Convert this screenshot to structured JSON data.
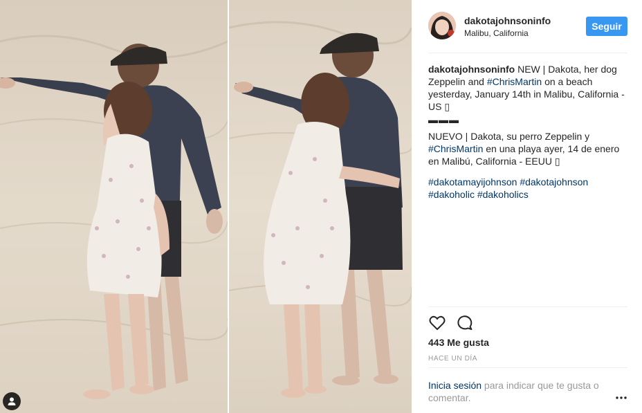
{
  "post": {
    "username": "dakotajohnsoninfo",
    "location": "Malibu, California",
    "follow_label": "Seguir"
  },
  "caption": {
    "author": "dakotajohnsoninfo",
    "part1_a": "NEW | Dakota, her dog Zeppelin and ",
    "hashtag1": "#ChrisMartin",
    "part1_b": " on a beach yesterday, January 14th in Malibu, California - US ",
    "flag1": "▯",
    "separator": "▬▬▬",
    "part2_a": "NUEVO | Dakota, su perro Zeppelin y ",
    "hashtag2": "#ChrisMartin",
    "part2_b": " en una playa ayer, 14 de enero en Malibú, California - EEUU ",
    "flag2": "▯",
    "tags": [
      "#dakotamayijohnson",
      "#dakotajohnson",
      "#dakoholic",
      "#dakoholics"
    ]
  },
  "actions": {
    "like_icon": "heart-icon",
    "comment_icon": "comment-icon"
  },
  "likes_text": "443 Me gusta",
  "timestamp": "HACE UN DÍA",
  "login": {
    "link_text": "Inicia sesión",
    "rest_text": " para indicar que te gusta o comentar."
  },
  "more_icon": "ellipsis-icon",
  "tag_user_icon": "user-tag-icon",
  "colors": {
    "follow_button": "#3897f0",
    "hashtag": "#003569",
    "muted": "#999999",
    "divider": "#efefef"
  }
}
